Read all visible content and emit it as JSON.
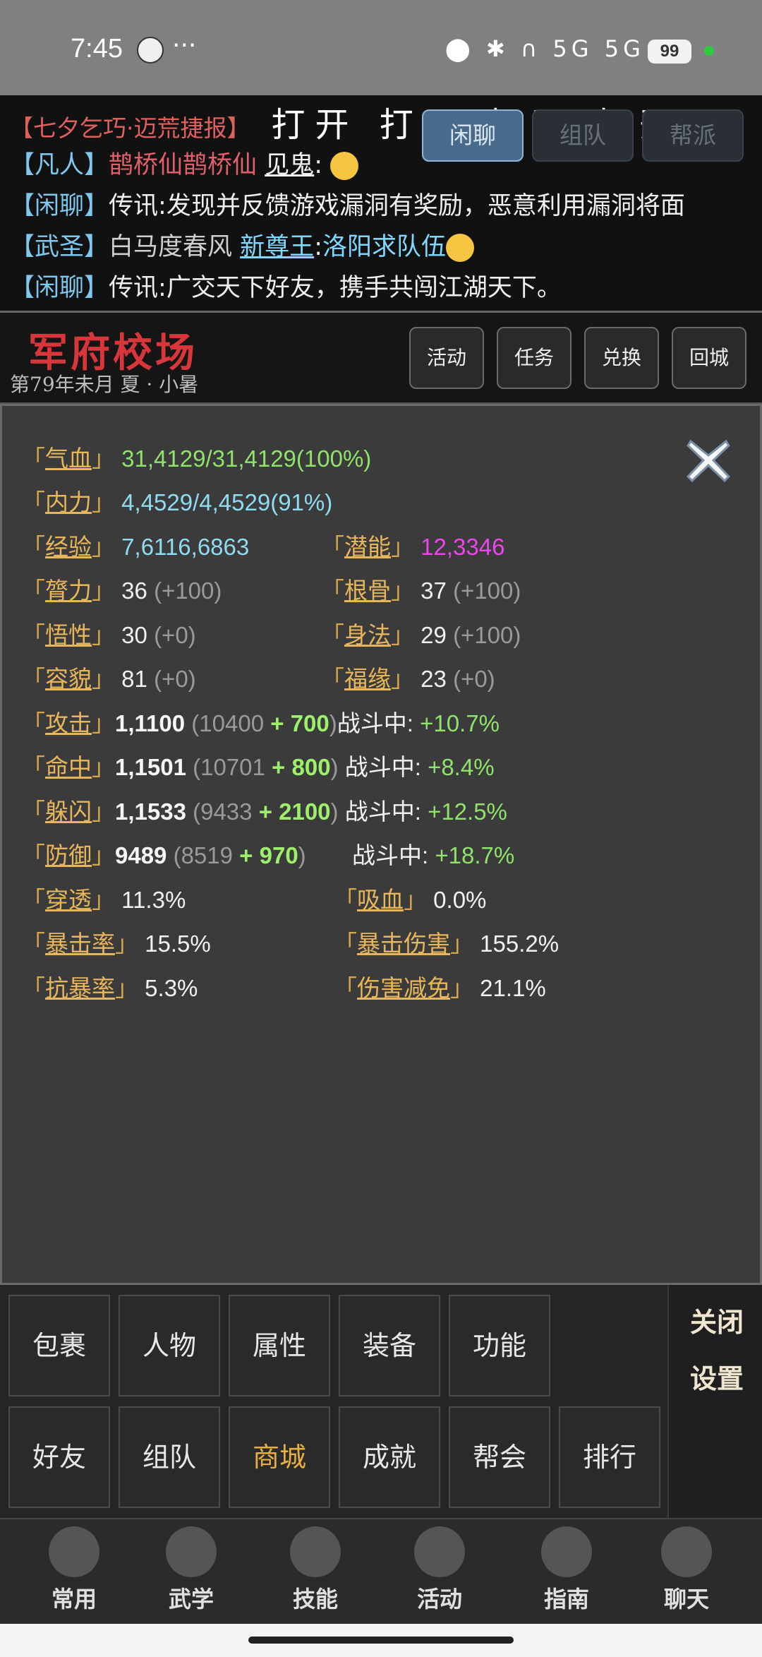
{
  "status_bar": {
    "time": "7:45",
    "more": "···",
    "network": "5G 5G",
    "battery": "99"
  },
  "chat": {
    "top_line": {
      "tag": "【七夕乞巧·迈荒捷报】",
      "big": "打开 打开 打开 打开"
    },
    "tabs": [
      "闲聊",
      "组队",
      "帮派"
    ],
    "lines": [
      {
        "tag": "【凡人】",
        "name": "鹊桥仙鹊桥仙",
        "target": "见鬼",
        "sep": ":",
        "text": ""
      },
      {
        "tag": "【闲聊】",
        "name": "传讯",
        "sep": ":",
        "text": "发现并反馈游戏漏洞有奖励，恶意利用漏洞将面"
      },
      {
        "tag": "【武圣】",
        "name": "白马度春风",
        "target": "新尊王",
        "sep": ":",
        "text": "洛阳求队伍"
      },
      {
        "tag": "【闲聊】",
        "name": "传讯",
        "sep": ":",
        "text": "广交天下好友，携手共闯江湖天下。"
      }
    ]
  },
  "header": {
    "title": "军府校场",
    "date": "第79年未月  夏 · 小暑",
    "buttons": [
      "活动",
      "任务",
      "兑换",
      "回城"
    ]
  },
  "stats": {
    "hp": {
      "label": "气血",
      "value": "31,4129/31,4129(100%)"
    },
    "mp": {
      "label": "内力",
      "value": "4,4529/4,4529(91%)"
    },
    "exp": {
      "label": "经验",
      "value": "7,6116,6863"
    },
    "potential": {
      "label": "潜能",
      "value": "12,3346"
    },
    "str": {
      "label": "膂力",
      "value": "36",
      "bonus": "(+100)"
    },
    "con": {
      "label": "根骨",
      "value": "37",
      "bonus": "(+100)"
    },
    "int": {
      "label": "悟性",
      "value": "30",
      "bonus": "(+0)"
    },
    "dex": {
      "label": "身法",
      "value": "29",
      "bonus": "(+100)"
    },
    "looks": {
      "label": "容貌",
      "value": "81",
      "bonus": "(+0)"
    },
    "luck": {
      "label": "福缘",
      "value": "23",
      "bonus": "(+0)"
    },
    "attack": {
      "label": "攻击",
      "value": "1,1100",
      "base": "(10400",
      "plus": "+ 700",
      "close": ")",
      "combat_label": "战斗中:",
      "combat": "+10.7%"
    },
    "hit": {
      "label": "命中",
      "value": "1,1501",
      "base": "(10701",
      "plus": "+ 800",
      "close": ")",
      "combat_label": "战斗中:",
      "combat": "+8.4%"
    },
    "dodge": {
      "label": "躲闪",
      "value": "1,1533",
      "base": "(9433",
      "plus": "+ 2100",
      "close": ")",
      "combat_label": "战斗中:",
      "combat": "+12.5%"
    },
    "defense": {
      "label": "防御",
      "value": "9489",
      "base": "(8519",
      "plus": "+ 970",
      "close": ")",
      "combat_label": "战斗中:",
      "combat": "+18.7%"
    },
    "pierce": {
      "label": "穿透",
      "value": "11.3%"
    },
    "lifesteal": {
      "label": "吸血",
      "value": "0.0%"
    },
    "crit_rate": {
      "label": "暴击率",
      "value": "15.5%"
    },
    "crit_dmg": {
      "label": "暴击伤害",
      "value": "155.2%"
    },
    "crit_resist": {
      "label": "抗暴率",
      "value": "5.3%"
    },
    "dmg_reduce": {
      "label": "伤害减免",
      "value": "21.1%"
    }
  },
  "menu": {
    "row1": [
      "包裹",
      "人物",
      "属性",
      "装备",
      "功能"
    ],
    "row2": [
      "好友",
      "组队",
      "商城",
      "成就",
      "帮会",
      "排行"
    ],
    "side": [
      "关闭",
      "设置"
    ]
  },
  "nav": [
    "常用",
    "武学",
    "技能",
    "活动",
    "指南",
    "聊天"
  ],
  "colors": {
    "accent_red": "#d8363a",
    "gold": "#e8b65a",
    "green": "#8fe36a"
  }
}
